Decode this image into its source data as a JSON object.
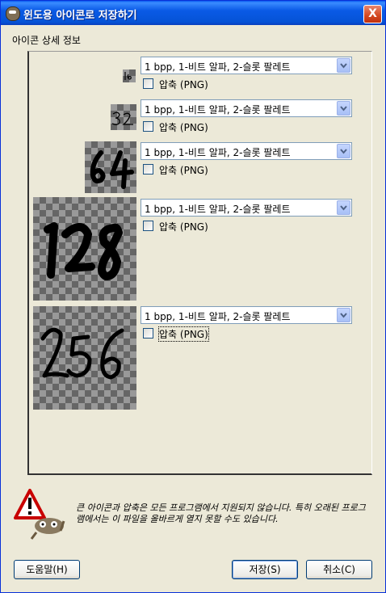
{
  "window": {
    "title": "윈도용 아이콘로 저장하기",
    "close_label": "X"
  },
  "section_label": "아이콘 상세 정보",
  "icons": [
    {
      "size_label": "16",
      "format": "1 bpp, 1-비트 알파, 2-슬롯 팔레트",
      "compress_label": "압축 (PNG)",
      "compressed": false
    },
    {
      "size_label": "32",
      "format": "1 bpp, 1-비트 알파, 2-슬롯 팔레트",
      "compress_label": "압축 (PNG)",
      "compressed": false
    },
    {
      "size_label": "64",
      "format": "1 bpp, 1-비트 알파, 2-슬롯 팔레트",
      "compress_label": "압축 (PNG)",
      "compressed": false
    },
    {
      "size_label": "128",
      "format": "1 bpp, 1-비트 알파, 2-슬롯 팔레트",
      "compress_label": "압축 (PNG)",
      "compressed": false
    },
    {
      "size_label": "256",
      "format": "1 bpp, 1-비트 알파, 2-슬롯 팔레트",
      "compress_label": "압축 (PNG)",
      "compressed": false
    }
  ],
  "warning": {
    "text": "큰 아이콘과 압축은 모든 프로그램에서 지원되지 않습니다. 특히 오래된 프로그램에서는 이 파일을 올바르게 열지 못할 수도 있습니다.",
    "icon": "warning-icon"
  },
  "buttons": {
    "help": "도움말(H)",
    "save": "저장(S)",
    "cancel": "취소(C)"
  },
  "colors": {
    "titlebar": "#0a5ae6",
    "background": "#ece9d8",
    "combo_border": "#7f9db9"
  }
}
